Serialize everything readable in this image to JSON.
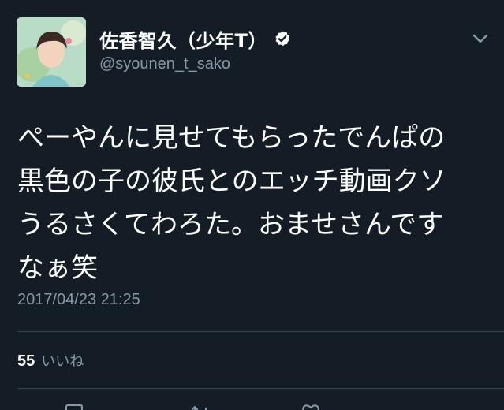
{
  "tweet": {
    "display_name": "佐香智久（少年T）",
    "username": "@syounen_t_sako",
    "verified": true,
    "avatar_icon": "profile-avatar",
    "text_lines": [
      "ぺーやんに見せてもらったでんぱの",
      "黒色の子の彼氏とのエッチ動画クソ",
      "うるさくてわろた。おませさんです",
      "なぁ笑"
    ],
    "timestamp": "2017/04/23 21:25",
    "likes_count": "55",
    "likes_label": "いいね"
  },
  "colors": {
    "background": "#141d26",
    "text_primary": "#ffffff",
    "text_secondary": "#8899a6",
    "divider": "#38444d"
  },
  "icons": {
    "verified": "verified-badge-icon",
    "menu": "chevron-down-icon",
    "actions": [
      "reply-icon",
      "retweet-icon",
      "like-icon"
    ]
  }
}
